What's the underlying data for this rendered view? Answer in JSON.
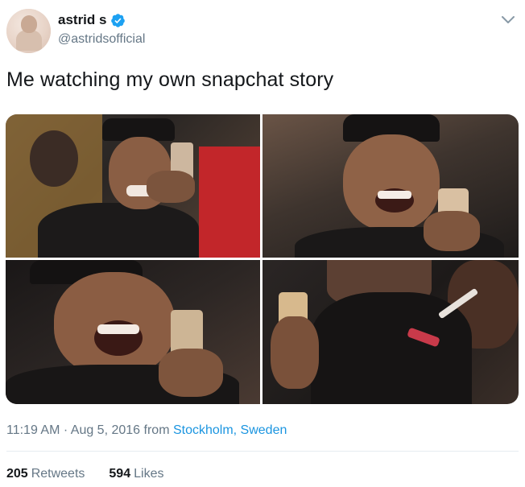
{
  "user": {
    "display_name": "astrid s",
    "handle": "@astridsofficial",
    "verified": true
  },
  "tweet": {
    "text": "Me watching my own snapchat story"
  },
  "media": {
    "photo_count": 4
  },
  "meta": {
    "time": "11:19 AM",
    "separator": "·",
    "date": "Aug 5, 2016",
    "from_label": "from",
    "location": "Stockholm, Sweden"
  },
  "stats": {
    "retweets_count": "205",
    "retweets_label": "Retweets",
    "likes_count": "594",
    "likes_label": "Likes"
  },
  "colors": {
    "link": "#1b95e0",
    "verified": "#1da1f2",
    "secondary_text": "#657786"
  },
  "icons": {
    "verified": "verified-badge-icon",
    "menu": "chevron-down-icon"
  }
}
